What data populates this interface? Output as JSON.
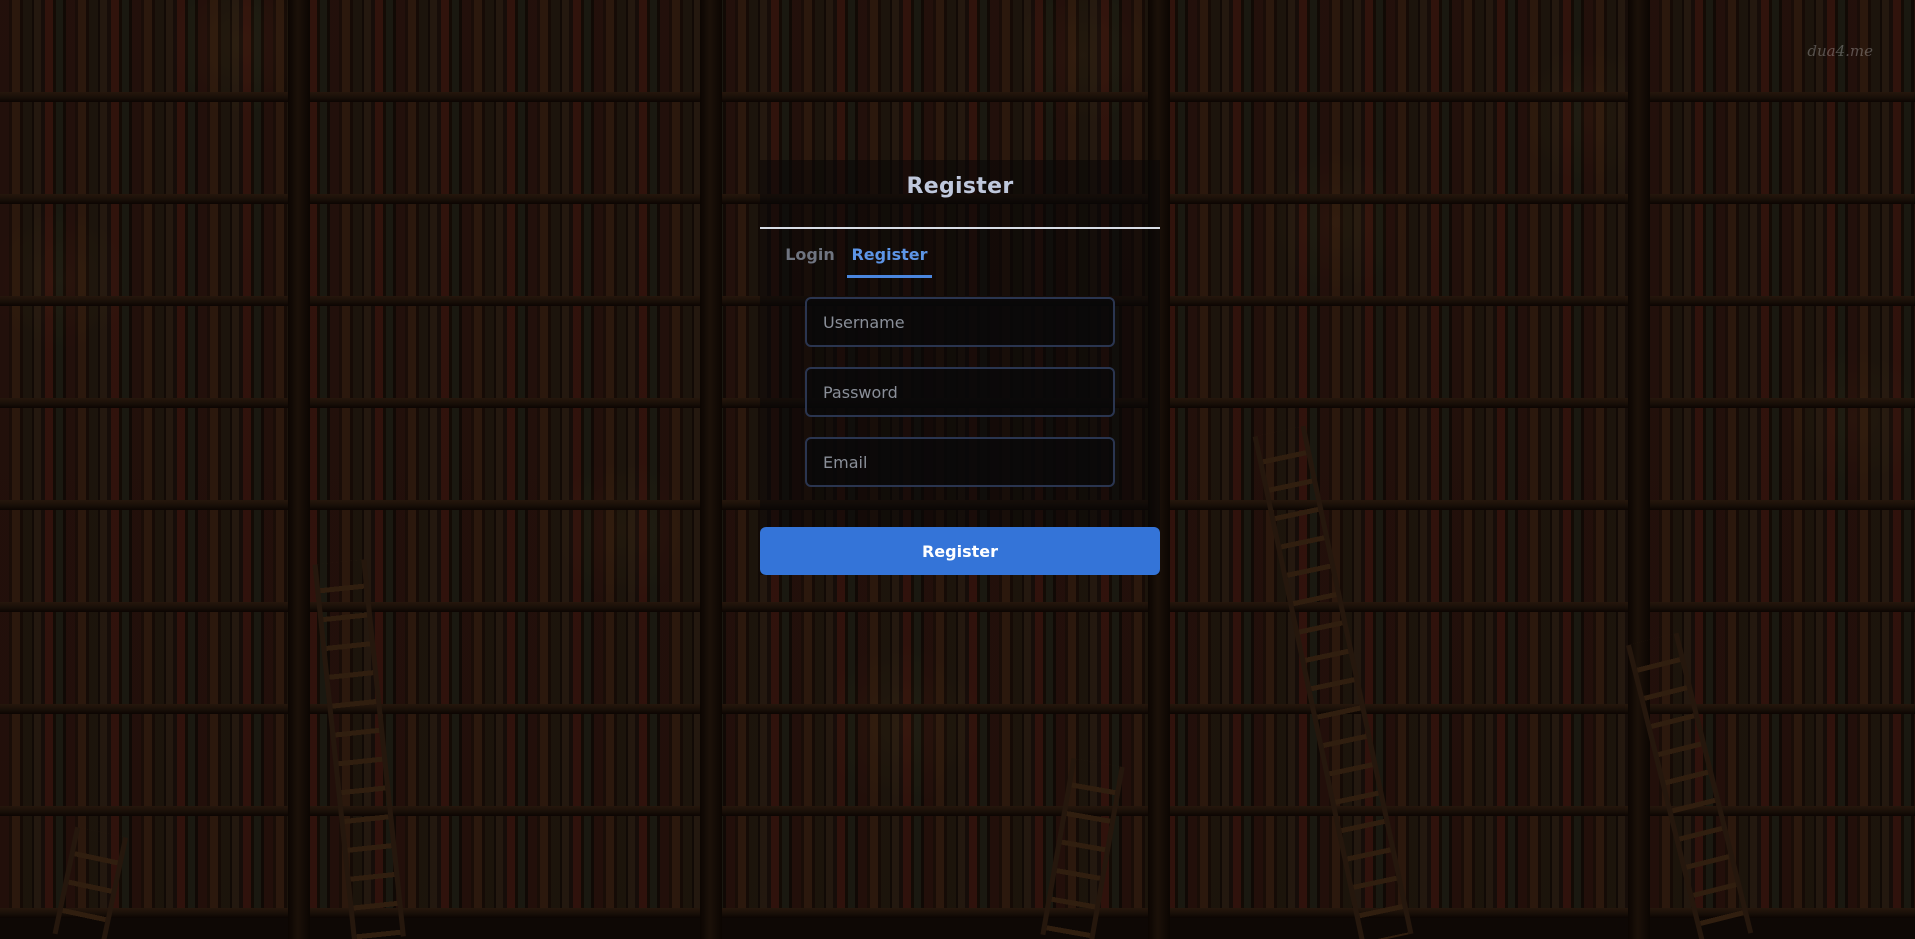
{
  "background": {
    "watermark": "dua4.me",
    "scene": "library bookshelves with candles and ladders"
  },
  "form": {
    "title": "Register",
    "tabs": [
      {
        "label": "Login",
        "active": false
      },
      {
        "label": "Register",
        "active": true
      }
    ],
    "fields": {
      "username_placeholder": "Username",
      "password_placeholder": "Password",
      "email_placeholder": "Email"
    },
    "submit_label": "Register"
  },
  "colors": {
    "accent": "#3474d8",
    "active_tab": "#5d95e6",
    "inactive_tab": "#6f7480",
    "title": "#bfc8dc"
  }
}
